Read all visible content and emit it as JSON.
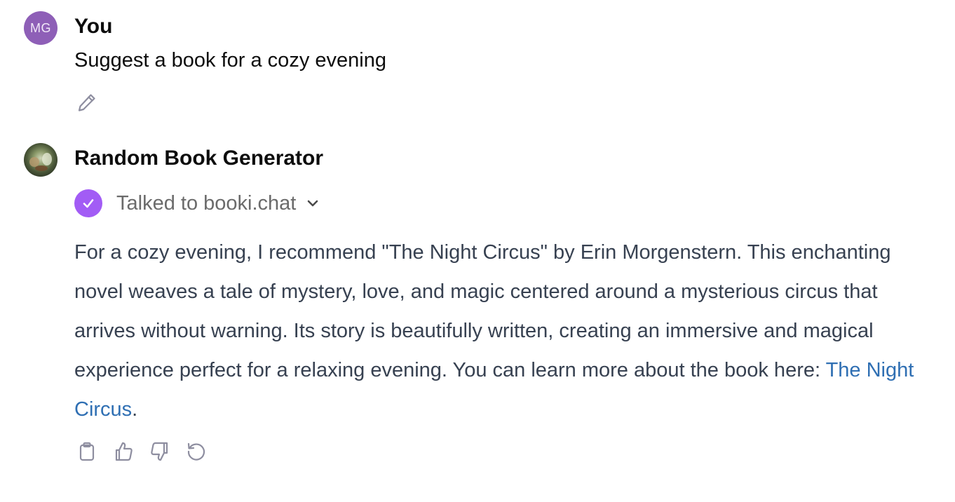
{
  "user_message": {
    "avatar_initials": "MG",
    "author": "You",
    "text": "Suggest a book for a cozy evening",
    "edit_icon": "pencil-icon"
  },
  "assistant_message": {
    "author": "Random Book Generator",
    "plugin": {
      "label": "Talked to booki.chat",
      "status_icon": "check-circle-icon",
      "toggle_icon": "chevron-down-icon"
    },
    "text_before_link": "For a cozy evening, I recommend \"The Night Circus\" by Erin Morgenstern. This enchanting novel weaves a tale of mystery, love, and magic centered around a mysterious circus that arrives without warning. Its story is beautifully written, creating an immersive and magical experience perfect for a relaxing evening. You can learn more about the book here: ",
    "link_text": "The Night Circus",
    "text_after_link": ".",
    "actions": [
      "copy-icon",
      "thumbs-up-icon",
      "thumbs-down-icon",
      "regenerate-icon"
    ]
  },
  "colors": {
    "user_avatar": "#8e5fb7",
    "plugin_check": "#a25cf5",
    "link": "#2f6fb3",
    "body_text": "#374151",
    "icon": "#8e8ea0"
  }
}
